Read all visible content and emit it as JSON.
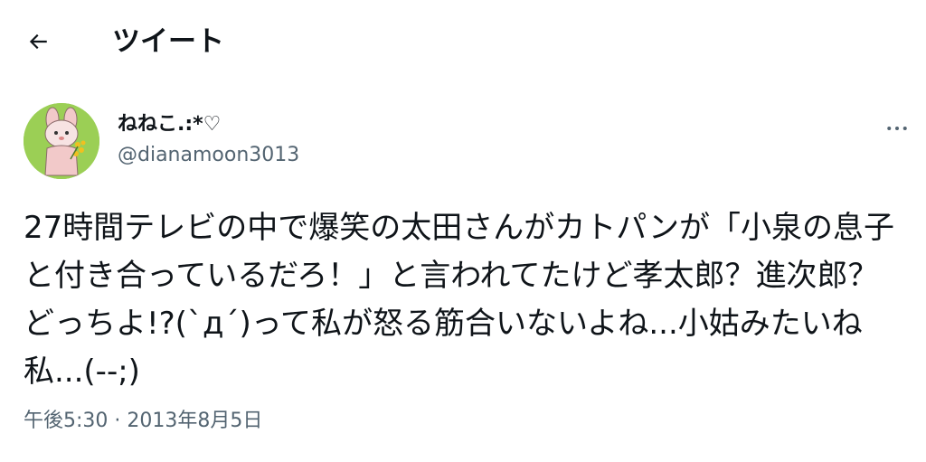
{
  "header": {
    "title": "ツイート",
    "back_icon": "arrow-left-icon"
  },
  "author": {
    "display_name": "ねねこ.:*♡",
    "username": "@dianamoon3013",
    "avatar_bg": "#9bcf55"
  },
  "tweet": {
    "text": "27時間テレビの中で爆笑の太田さんがカトパンが「小泉の息子と付き合っているだろ！」と言われてたけど孝太郎？進次郎？どっちよ!?(`д´)って私が怒る筋合いないよね...小姑みたいね私...(--;)",
    "time": "午後5:30",
    "separator": "·",
    "date": "2013年8月5日"
  },
  "colors": {
    "text": "#0f1419",
    "secondary": "#536471",
    "background": "#ffffff"
  },
  "icons": {
    "more": "more-horizontal-icon"
  }
}
